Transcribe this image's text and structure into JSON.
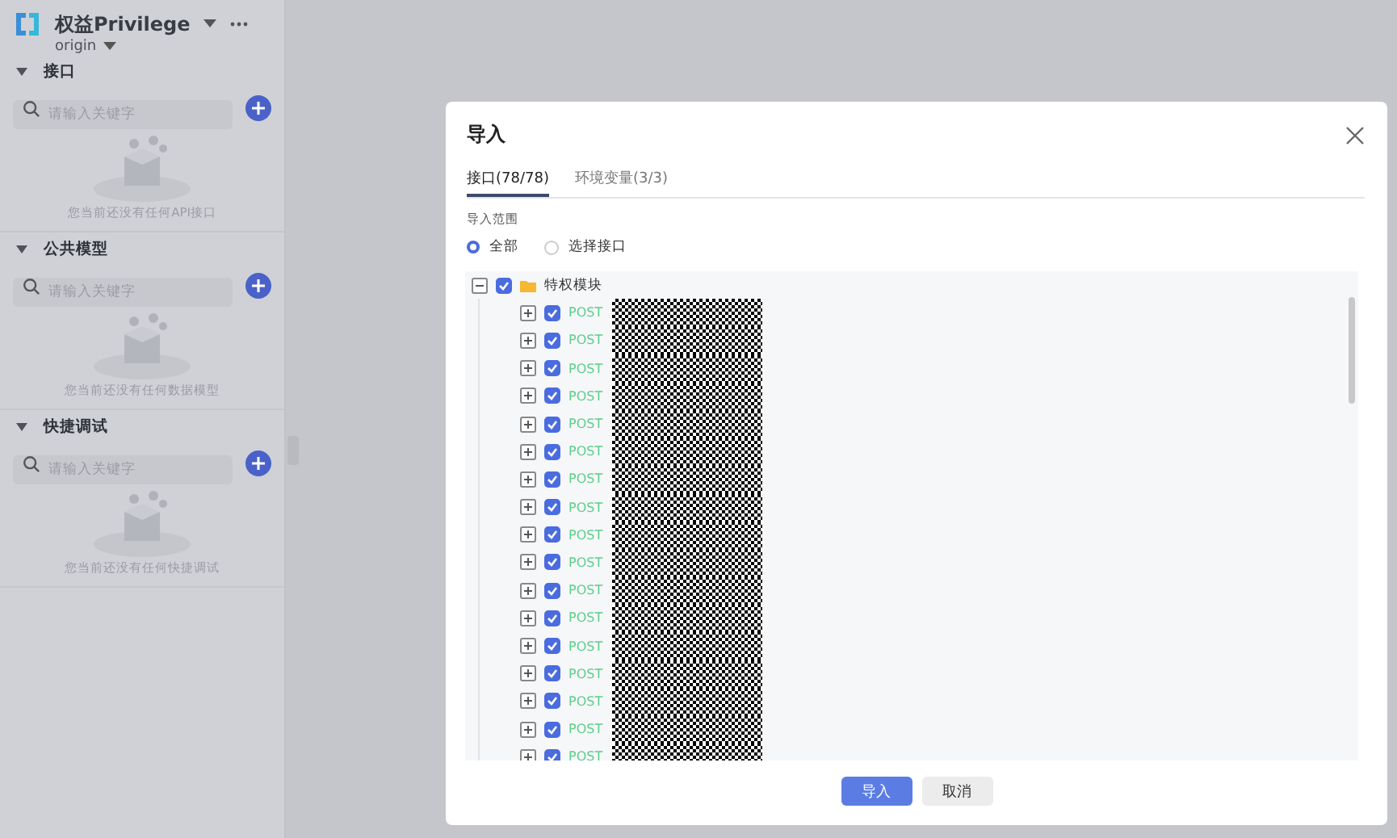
{
  "project": {
    "name": "权益Privilege",
    "branch": "origin"
  },
  "sidebar": {
    "sections": [
      {
        "title": "接口",
        "search": {
          "placeholder": "请输入关键字"
        },
        "empty_text": "您当前还没有任何API接口"
      },
      {
        "title": "公共模型",
        "search": {
          "placeholder": "请输入关键字"
        },
        "empty_text": "您当前还没有任何数据模型"
      },
      {
        "title": "快捷调试",
        "search": {
          "placeholder": "请输入关键字"
        },
        "empty_text": "您当前还没有任何快捷调试"
      }
    ]
  },
  "dialog": {
    "title": "导入",
    "tabs": [
      {
        "label": "接口(78/78)",
        "selected": true
      },
      {
        "label": "环境变量(3/3)",
        "selected": false
      }
    ],
    "range_label": "导入范围",
    "range_options": [
      {
        "label": "全部",
        "selected": true
      },
      {
        "label": "选择接口",
        "selected": false
      }
    ],
    "tree": {
      "label": "特权模块",
      "checked": true,
      "expanded": true,
      "children": [
        {
          "method": "POST",
          "checked": true,
          "expanded": false
        },
        {
          "method": "POST",
          "checked": true,
          "expanded": false
        },
        {
          "method": "POST",
          "checked": true,
          "expanded": false
        },
        {
          "method": "POST",
          "checked": true,
          "expanded": false
        },
        {
          "method": "POST",
          "checked": true,
          "expanded": false
        },
        {
          "method": "POST",
          "checked": true,
          "expanded": false
        },
        {
          "method": "POST",
          "checked": true,
          "expanded": false
        },
        {
          "method": "POST",
          "checked": true,
          "expanded": false
        },
        {
          "method": "POST",
          "checked": true,
          "expanded": false
        },
        {
          "method": "POST",
          "checked": true,
          "expanded": false
        },
        {
          "method": "POST",
          "checked": true,
          "expanded": false
        },
        {
          "method": "POST",
          "checked": true,
          "expanded": false
        },
        {
          "method": "POST",
          "checked": true,
          "expanded": false
        },
        {
          "method": "POST",
          "checked": true,
          "expanded": false
        },
        {
          "method": "POST",
          "checked": true,
          "expanded": false
        },
        {
          "method": "POST",
          "checked": true,
          "expanded": false
        },
        {
          "method": "POST",
          "checked": true,
          "expanded": false
        }
      ]
    },
    "buttons": [
      {
        "label": "导入",
        "kind": "primary"
      },
      {
        "label": "取消",
        "kind": "secondary"
      }
    ]
  }
}
